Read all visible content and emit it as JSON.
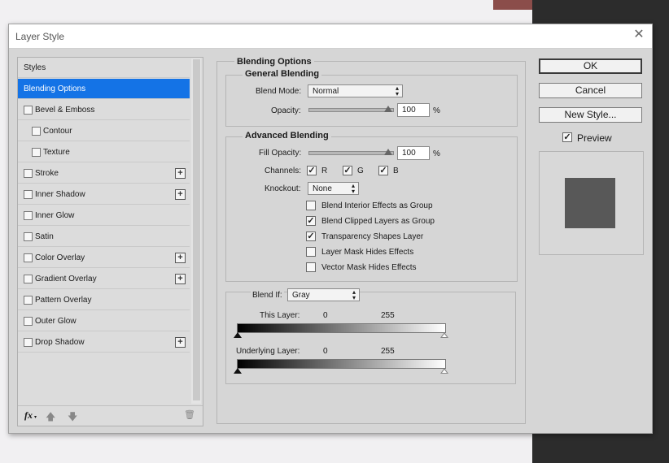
{
  "dialog": {
    "title": "Layer Style",
    "close": "✕"
  },
  "sidebar": {
    "header": "Styles",
    "items": [
      {
        "label": "Blending Options",
        "checkbox": false,
        "plus": false,
        "selected": true
      },
      {
        "label": "Bevel & Emboss",
        "checkbox": true,
        "plus": false
      },
      {
        "label": "Contour",
        "checkbox": true,
        "plus": false,
        "indent": true
      },
      {
        "label": "Texture",
        "checkbox": true,
        "plus": false,
        "indent": true
      },
      {
        "label": "Stroke",
        "checkbox": true,
        "plus": true
      },
      {
        "label": "Inner Shadow",
        "checkbox": true,
        "plus": true
      },
      {
        "label": "Inner Glow",
        "checkbox": true,
        "plus": false
      },
      {
        "label": "Satin",
        "checkbox": true,
        "plus": false
      },
      {
        "label": "Color Overlay",
        "checkbox": true,
        "plus": true
      },
      {
        "label": "Gradient Overlay",
        "checkbox": true,
        "plus": true
      },
      {
        "label": "Pattern Overlay",
        "checkbox": true,
        "plus": false
      },
      {
        "label": "Outer Glow",
        "checkbox": true,
        "plus": false
      },
      {
        "label": "Drop Shadow",
        "checkbox": true,
        "plus": true
      }
    ],
    "plus_glyph": "+",
    "fx_label": "fx",
    "fx_caret": "▾",
    "up_icon": "🡅",
    "down_icon": "🡇",
    "trash_icon": "🗑"
  },
  "blending": {
    "section_title": "Blending Options",
    "general_title": "General Blending",
    "blend_mode_label": "Blend Mode:",
    "blend_mode_value": "Normal",
    "opacity_label": "Opacity:",
    "opacity_value": "100",
    "percent": "%",
    "opacity_level": 1.0,
    "advanced_title": "Advanced Blending",
    "fill_opacity_label": "Fill Opacity:",
    "fill_opacity_value": "100",
    "fill_opacity_level": 1.0,
    "channels_label": "Channels:",
    "channels": [
      {
        "label": "R",
        "checked": true
      },
      {
        "label": "G",
        "checked": true
      },
      {
        "label": "B",
        "checked": true
      }
    ],
    "knockout_label": "Knockout:",
    "knockout_value": "None",
    "options": [
      {
        "label": "Blend Interior Effects as Group",
        "checked": false
      },
      {
        "label": "Blend Clipped Layers as Group",
        "checked": true
      },
      {
        "label": "Transparency Shapes Layer",
        "checked": true
      },
      {
        "label": "Layer Mask Hides Effects",
        "checked": false
      },
      {
        "label": "Vector Mask Hides Effects",
        "checked": false
      }
    ],
    "blend_if_label": "Blend If:",
    "blend_if_value": "Gray",
    "this_layer_label": "This Layer:",
    "this_layer_min": "0",
    "this_layer_max": "255",
    "underlying_label": "Underlying Layer:",
    "underlying_min": "0",
    "underlying_max": "255"
  },
  "buttons": {
    "ok": "OK",
    "cancel": "Cancel",
    "new_style": "New Style...",
    "preview_label": "Preview",
    "preview_checked": true
  },
  "icons": {
    "check": "✓",
    "updown": "▴▾"
  },
  "colors": {
    "selection": "#1473e6",
    "preview_swatch": "#585858"
  }
}
